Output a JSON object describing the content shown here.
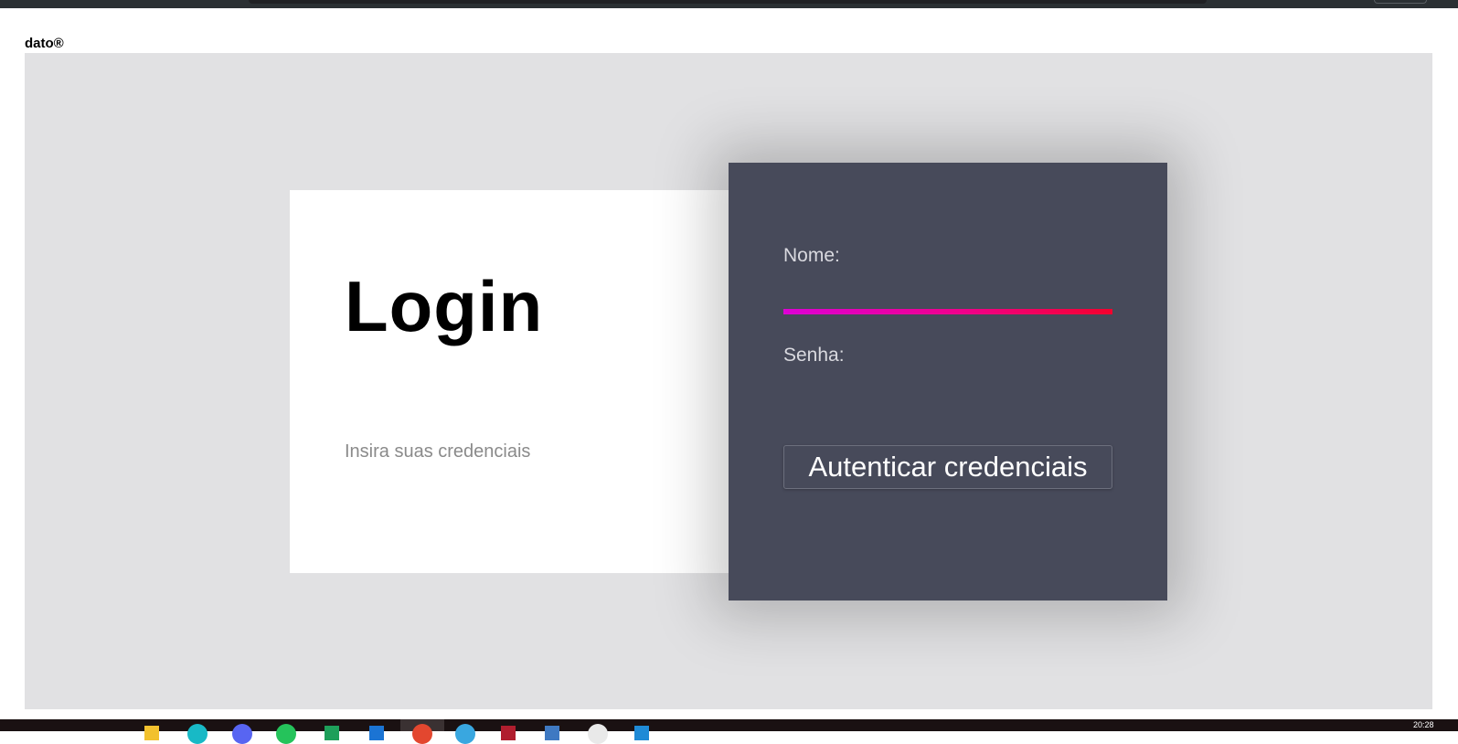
{
  "brand": {
    "text": "dato®"
  },
  "login": {
    "title": "Login",
    "subtitle": "Insira suas credenciais",
    "name_label": "Nome:",
    "name_value": "",
    "password_label": "Senha:",
    "password_value": "",
    "submit_label": "Autenticar credenciais"
  },
  "taskbar": {
    "clock": "20:28",
    "icons": [
      "file-explorer-icon",
      "browser-icon",
      "discord-icon",
      "whatsapp-icon",
      "sheets-icon",
      "store-icon",
      "chrome-icon",
      "edge-icon",
      "mail-icon",
      "calendar-icon",
      "photos-icon",
      "vscode-icon"
    ]
  },
  "colors": {
    "panel": "#474a5a",
    "stage": "#e1e1e3",
    "accent_start": "#dd00d5",
    "accent_end": "#f5002c"
  }
}
